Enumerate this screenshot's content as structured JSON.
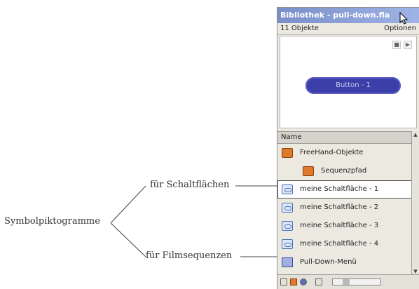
{
  "annotations": {
    "root": "Symbolpiktogramme",
    "buttons": "für Schaltflächen",
    "movies": "für Filmsequenzen"
  },
  "library": {
    "title": "Bibliothek - pull-down.fla",
    "count": "11 Objekte",
    "options": "Optionen",
    "preview_button_label": "Button - 1",
    "column_name": "Name",
    "items": [
      {
        "label": "FreeHand-Objekte",
        "icon": "folder-icon"
      },
      {
        "label": "Sequenzpfad",
        "icon": "folder-icon"
      },
      {
        "label": "meine Schaltfläche - 1",
        "icon": "button-symbol-icon"
      },
      {
        "label": "meine Schaltfläche - 2",
        "icon": "button-symbol-icon"
      },
      {
        "label": "meine Schaltfläche - 3",
        "icon": "button-symbol-icon"
      },
      {
        "label": "meine Schaltfläche - 4",
        "icon": "button-symbol-icon"
      },
      {
        "label": "Pull-Down-Menü",
        "icon": "movie-clip-icon"
      }
    ]
  },
  "colors": {
    "titlebar": "#7a8fc8",
    "preview_button": "#3d3fa8",
    "folder": "#e07a2a"
  }
}
